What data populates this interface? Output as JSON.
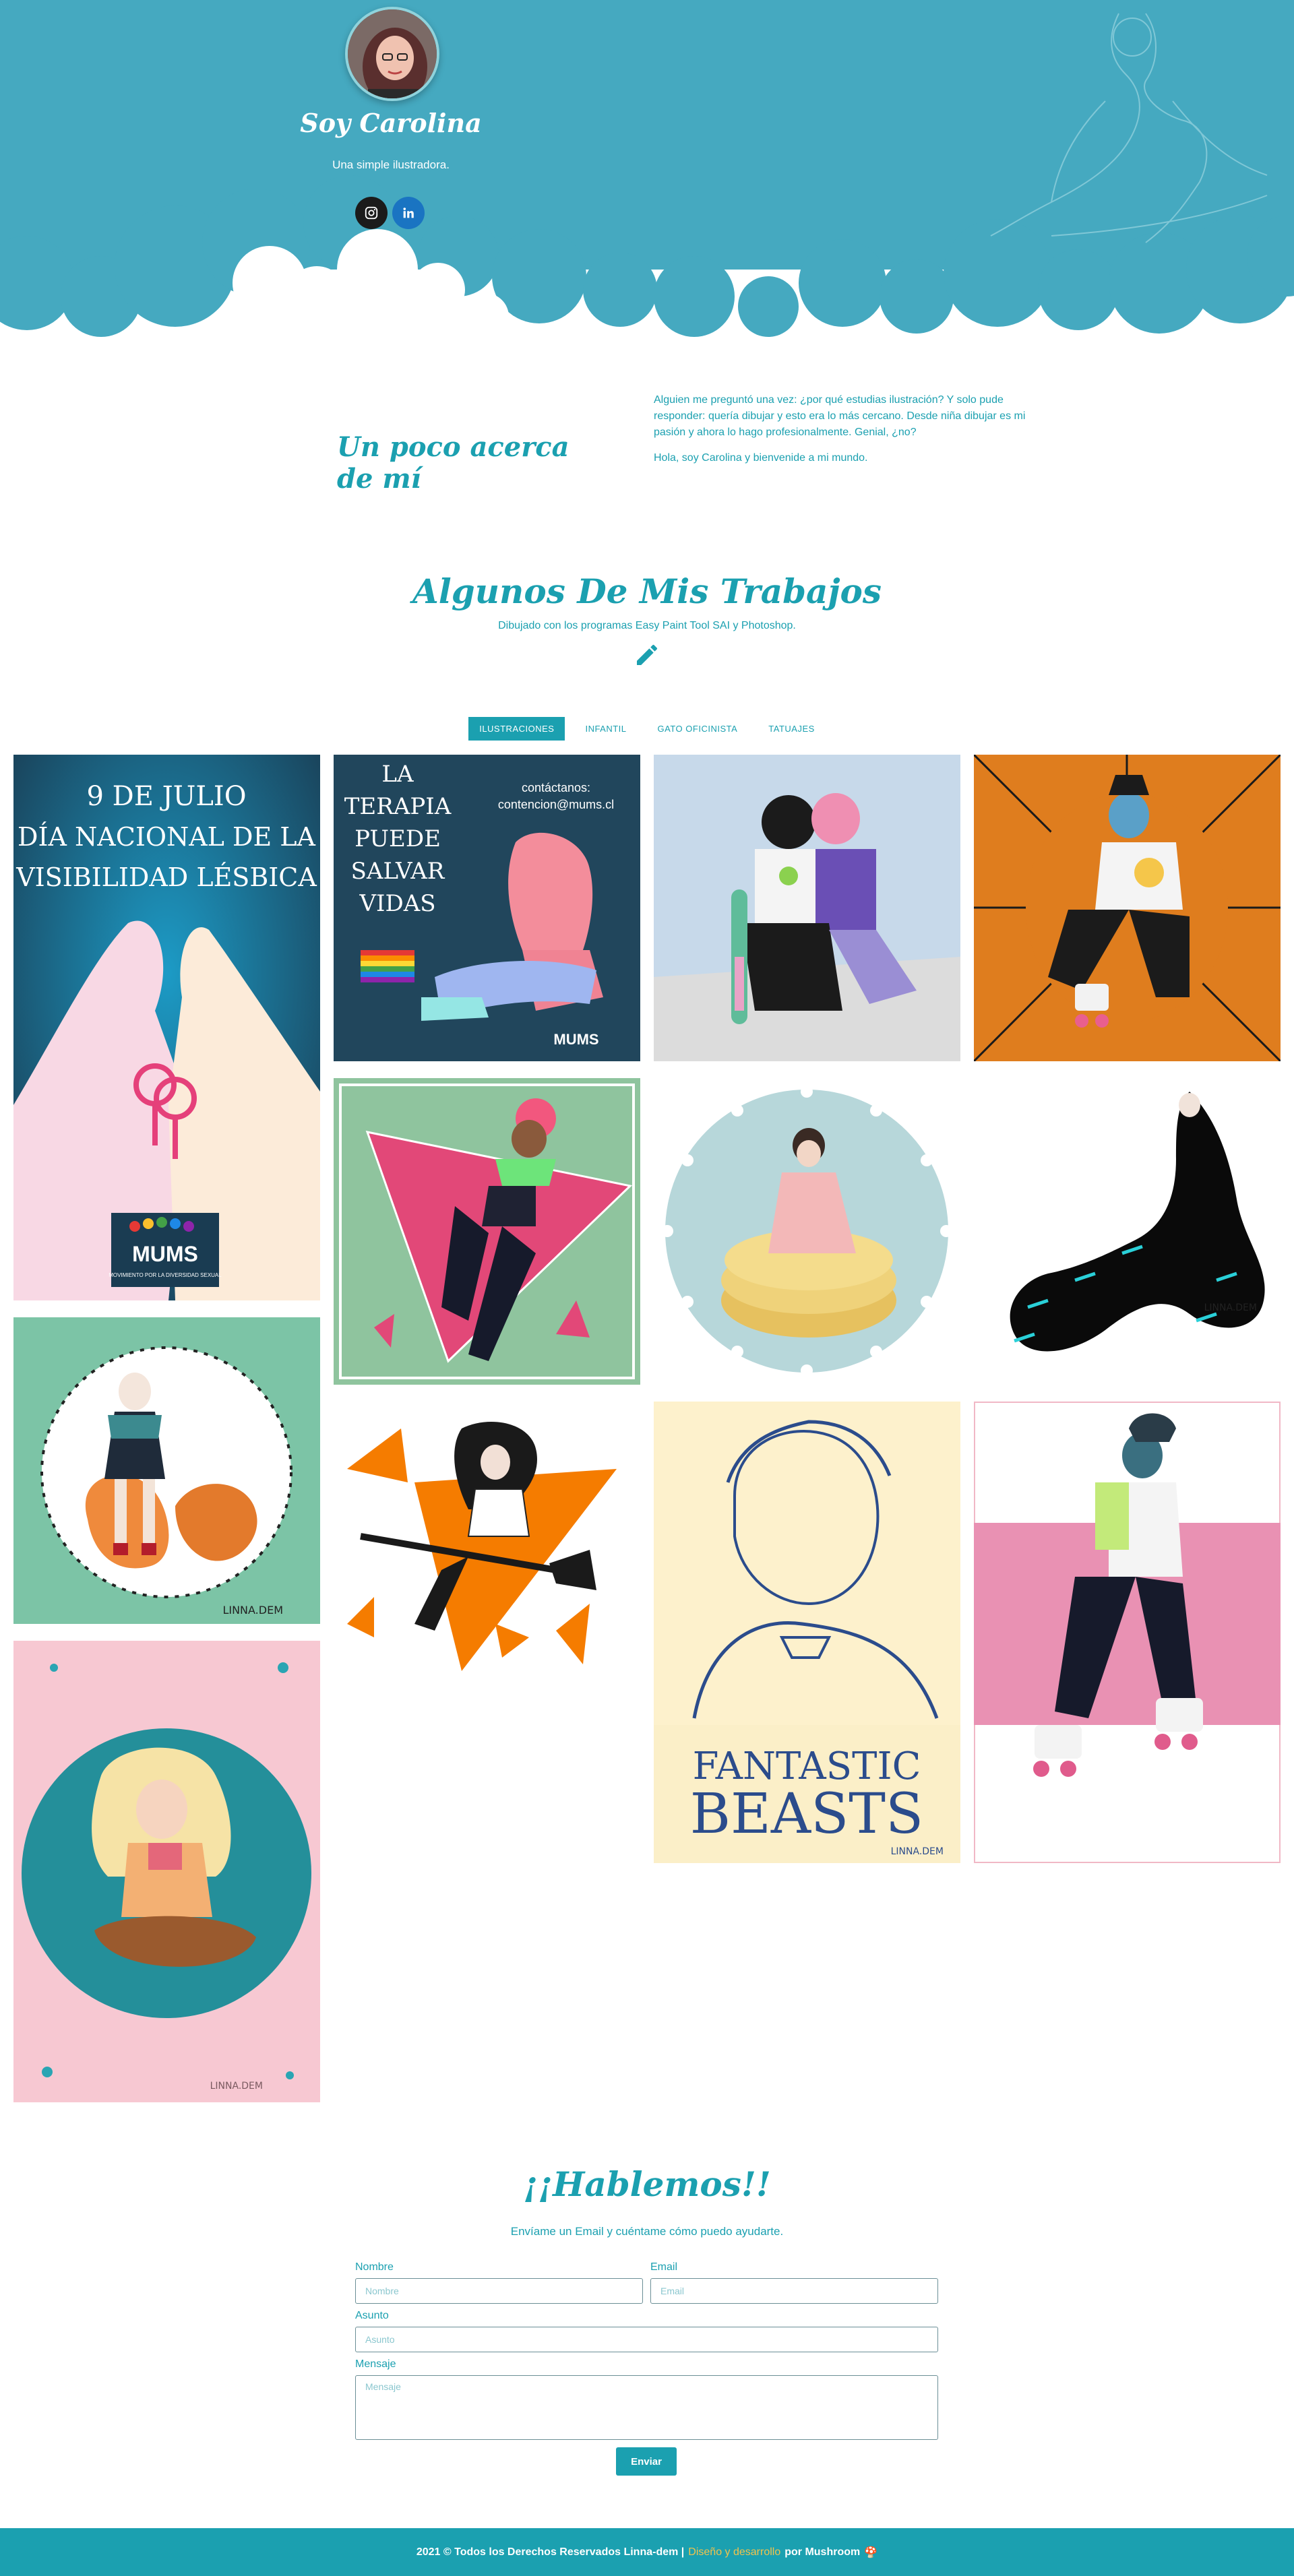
{
  "hero": {
    "title": "Soy Carolina",
    "subtitle": "Una simple ilustradora.",
    "avatar_alt": "avatar",
    "social": [
      {
        "name": "instagram-icon"
      },
      {
        "name": "linkedin-icon"
      }
    ]
  },
  "about": {
    "title": "Un poco acerca de mí",
    "paragraph1": "Alguien me preguntó una vez: ¿por qué estudias ilustración? Y solo pude responder: quería dibujar y esto era lo más cercano. Desde niña dibujar es mi pasión y ahora lo hago profesionalmente. Genial, ¿no?",
    "paragraph2": "Hola, soy Carolina y bienvenide a mi mundo."
  },
  "works": {
    "title": "Algunos De Mis Trabajos",
    "subtitle": "Dibujado con los programas Easy Paint Tool SAI y Photoshop.",
    "tabs": [
      "ILUSTRACIONES",
      "INFANTIL",
      "GATO OFICINISTA",
      "TATUAJES"
    ],
    "active_tab": "ILUSTRACIONES",
    "poster1": {
      "line1": "9 DE JULIO",
      "line2": "DÍA NACIONAL DE LA",
      "line3": "VISIBILIDAD LÉSBICA",
      "logo": "MUMS",
      "logo_sub": "MOVIMIENTO POR LA DIVERSIDAD SEXUAL"
    },
    "poster2": {
      "line1": "LA",
      "line2": "TERAPIA",
      "line3": "PUEDE",
      "line4": "SALVAR",
      "line5": "VIDAS",
      "contact1": "contáctanos:",
      "contact2": "contencion@mums.cl",
      "logo": "MUMS"
    },
    "poster3": {
      "line1": "FANTASTIC",
      "line2": "BEASTS",
      "signature": "LINNA.DEM"
    },
    "signature": "LINNA.DEM"
  },
  "contact": {
    "title": "¡¡Hablemos!!",
    "subtitle": "Envíame un Email y cuéntame cómo puedo ayudarte.",
    "name_label": "Nombre",
    "name_placeholder": "Nombre",
    "email_label": "Email",
    "email_placeholder": "Email",
    "subject_label": "Asunto",
    "subject_placeholder": "Asunto",
    "message_label": "Mensaje",
    "message_placeholder": "Mensaje",
    "send_label": "Enviar"
  },
  "footer": {
    "copyright": "2021 © Todos los Derechos Reservados Linna-dem |",
    "design": "Diseño y desarrollo",
    "by": "por Mushroom",
    "emoji": "🍄"
  },
  "colors": {
    "teal": "#1ba0b0",
    "hero_bg": "#45a9c0",
    "accent": "#f3c34b"
  }
}
